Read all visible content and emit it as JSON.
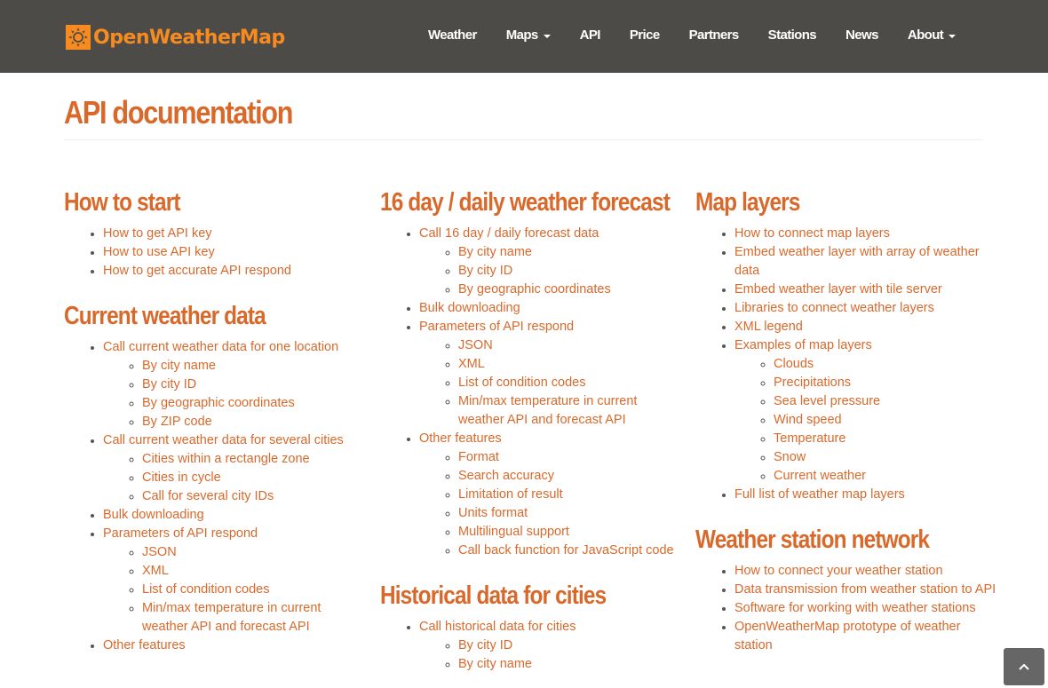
{
  "brand": {
    "name": "OpenWeatherMap",
    "icon": "sun-icon",
    "color": "#f88b1f"
  },
  "nav": [
    {
      "label": "Weather",
      "dropdown": false
    },
    {
      "label": "Maps",
      "dropdown": true
    },
    {
      "label": "API",
      "dropdown": false
    },
    {
      "label": "Price",
      "dropdown": false
    },
    {
      "label": "Partners",
      "dropdown": false
    },
    {
      "label": "Stations",
      "dropdown": false
    },
    {
      "label": "News",
      "dropdown": false
    },
    {
      "label": "About",
      "dropdown": true
    }
  ],
  "page": {
    "title": "API documentation",
    "accent": "#d9692b"
  },
  "sections": {
    "how_to_start": {
      "title": "How to start",
      "items": [
        "How to get API key",
        "How to use API key",
        "How to get accurate API respond"
      ]
    },
    "current": {
      "title": "Current weather data",
      "items": [
        {
          "label": "Call current weather data for one location",
          "sub": [
            "By city name",
            "By city ID",
            "By geographic coordinates",
            "By ZIP code"
          ]
        },
        {
          "label": "Call current weather data for several cities",
          "sub": [
            "Cities within a rectangle zone",
            "Cities in cycle",
            "Call for several city IDs"
          ]
        },
        {
          "label": "Bulk downloading",
          "sub": []
        },
        {
          "label": "Parameters of API respond",
          "sub": [
            "JSON",
            "XML",
            "List of condition codes",
            "Min/max temperature in current weather API and forecast API"
          ]
        },
        {
          "label": "Other features",
          "sub": []
        }
      ]
    },
    "forecast16": {
      "title": "16 day / daily weather forecast",
      "items": [
        {
          "label": "Call 16 day / daily forecast data",
          "sub": [
            "By city name",
            "By city ID",
            "By geographic coordinates"
          ]
        },
        {
          "label": "Bulk downloading",
          "sub": []
        },
        {
          "label": "Parameters of API respond",
          "sub": [
            "JSON",
            "XML",
            "List of condition codes",
            "Min/max temperature in current weather API and forecast API"
          ]
        },
        {
          "label": "Other features",
          "sub": [
            "Format",
            "Search accuracy",
            "Limitation of result",
            "Units format",
            "Multilingual support",
            "Call back function for JavaScript code"
          ]
        }
      ]
    },
    "historical": {
      "title": "Historical data for cities",
      "items": [
        {
          "label": "Call historical data for cities",
          "sub": [
            "By city ID",
            "By city name"
          ]
        }
      ]
    },
    "map_layers": {
      "title": "Map layers",
      "items": [
        {
          "label": "How to connect map layers",
          "sub": []
        },
        {
          "label": "Embed weather layer with array of weather data",
          "sub": []
        },
        {
          "label": "Embed weather layer with tile server",
          "sub": []
        },
        {
          "label": "Libraries to connect weather layers",
          "sub": []
        },
        {
          "label": "XML legend",
          "sub": []
        },
        {
          "label": "Examples of map layers",
          "sub": [
            "Clouds",
            "Precipitations",
            "Sea level pressure",
            "Wind speed",
            "Temperature",
            "Snow",
            "Current weather"
          ]
        },
        {
          "label": "Full list of weather map layers",
          "sub": []
        }
      ]
    },
    "stations": {
      "title": "Weather station network",
      "items": [
        "How to connect your weather station",
        "Data transmission from weather station to API",
        "Software for working with weather stations",
        "OpenWeatherMap prototype of weather station"
      ]
    }
  },
  "scroll_top": {
    "icon": "chevron-up-icon"
  }
}
